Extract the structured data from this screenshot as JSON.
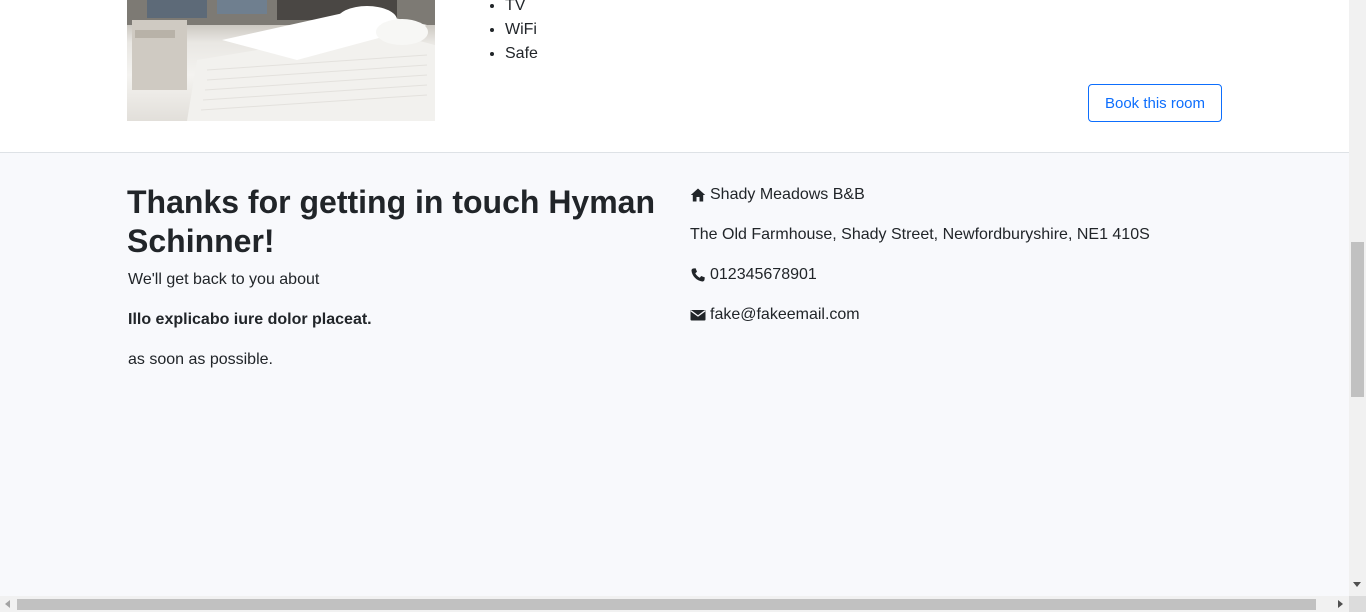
{
  "room": {
    "photo_alt": "Room photo",
    "features": [
      "TV",
      "WiFi",
      "Safe"
    ],
    "book_label": "Book this room"
  },
  "contact": {
    "title": "Thanks for getting in touch Hyman Schinner!",
    "line1": "We'll get back to you about",
    "subject": "Illo explicabo iure dolor placeat.",
    "line3": "as soon as possible."
  },
  "info": {
    "name": "Shady Meadows B&B",
    "address": "The Old Farmhouse, Shady Street, Newfordburyshire, NE1 410S",
    "phone": "012345678901",
    "email": "fake@fakeemail.com",
    "icons": {
      "home": "home-icon",
      "phone": "phone-icon",
      "email": "envelope-icon"
    }
  },
  "colors": {
    "accent": "#0d6efd",
    "contact_bg": "#f8f9fc",
    "text": "#212529"
  }
}
